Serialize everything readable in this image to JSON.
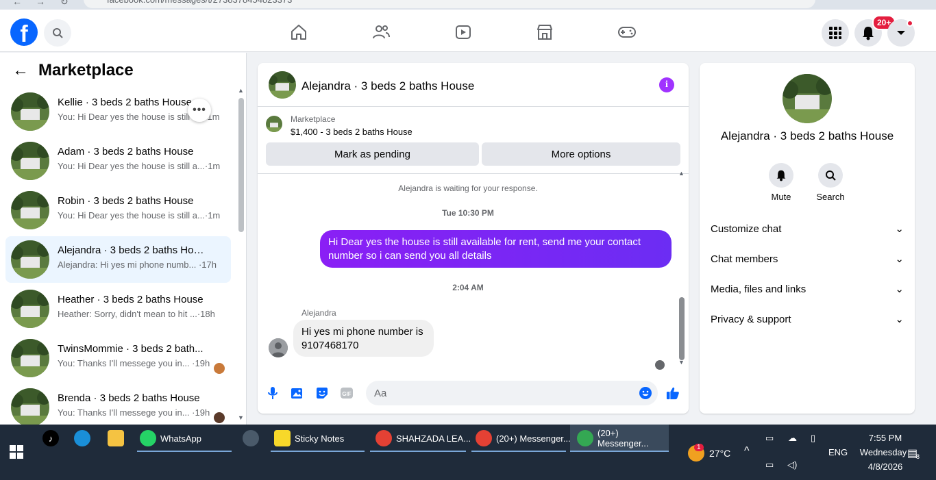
{
  "browser": {
    "url": "facebook.com/messages/t/2738378454823373"
  },
  "topnav": {
    "notification_badge": "20+"
  },
  "marketplace": {
    "title": "Marketplace",
    "conversations": [
      {
        "name": "Kellie · 3 beds 2 baths House",
        "preview": "You: Hi Dear yes the house is still a...",
        "time": "1m"
      },
      {
        "name": "Adam · 3 beds 2 baths House",
        "preview": "You: Hi Dear yes the house is still a...",
        "time": "·1m"
      },
      {
        "name": "Robin · 3 beds 2 baths House",
        "preview": "You: Hi Dear yes the house is still a...",
        "time": "·1m"
      },
      {
        "name": "Alejandra · 3 beds 2 baths House",
        "preview": "Alejandra: Hi yes mi phone numb...",
        "time": "·17h"
      },
      {
        "name": "Heather · 3 beds 2 baths House",
        "preview": "Heather: Sorry, didn't mean to hit ...",
        "time": "·18h"
      },
      {
        "name": "TwinsMommie · 3 beds 2 bath...",
        "preview": "You: Thanks I'll messege you in...",
        "time": "·19h"
      },
      {
        "name": "Brenda · 3 beds 2 baths House",
        "preview": "You: Thanks I'll messege you in...",
        "time": "·19h"
      }
    ]
  },
  "chat": {
    "title": "Alejandra · 3 beds 2 baths House",
    "listing_label": "Marketplace",
    "listing_price": "$1,400 - 3 beds 2 baths House",
    "mark_pending": "Mark as pending",
    "more_options": "More options",
    "waiting_notice": "Alejandra is waiting for your response.",
    "timestamp_1": "Tue 10:30 PM",
    "outgoing_message": "Hi Dear yes the house is still available for rent, send me your contact number so i can send you all details",
    "timestamp_2": "2:04 AM",
    "sender_name": "Alejandra",
    "incoming_message": "Hi yes mi phone number is 9107468170",
    "composer_placeholder": "Aa",
    "accent_color": "#7f21f3"
  },
  "details": {
    "name": "Alejandra · 3 beds 2 baths House",
    "mute_label": "Mute",
    "search_label": "Search",
    "sections": [
      "Customize chat",
      "Chat members",
      "Media, files and links",
      "Privacy & support"
    ]
  },
  "taskbar": {
    "apps": [
      {
        "label": "WhatsApp"
      },
      {
        "label": "Sticky Notes"
      },
      {
        "label": "SHAHZADA LEA..."
      },
      {
        "label": "(20+) Messenger..."
      },
      {
        "label": "(20+) Messenger..."
      }
    ],
    "weather": "27°C",
    "language": "ENG",
    "time": "7:55 PM",
    "day": "Wednesday",
    "date": "4/8/2026",
    "notification_count": "8",
    "weather_alert": "1"
  }
}
